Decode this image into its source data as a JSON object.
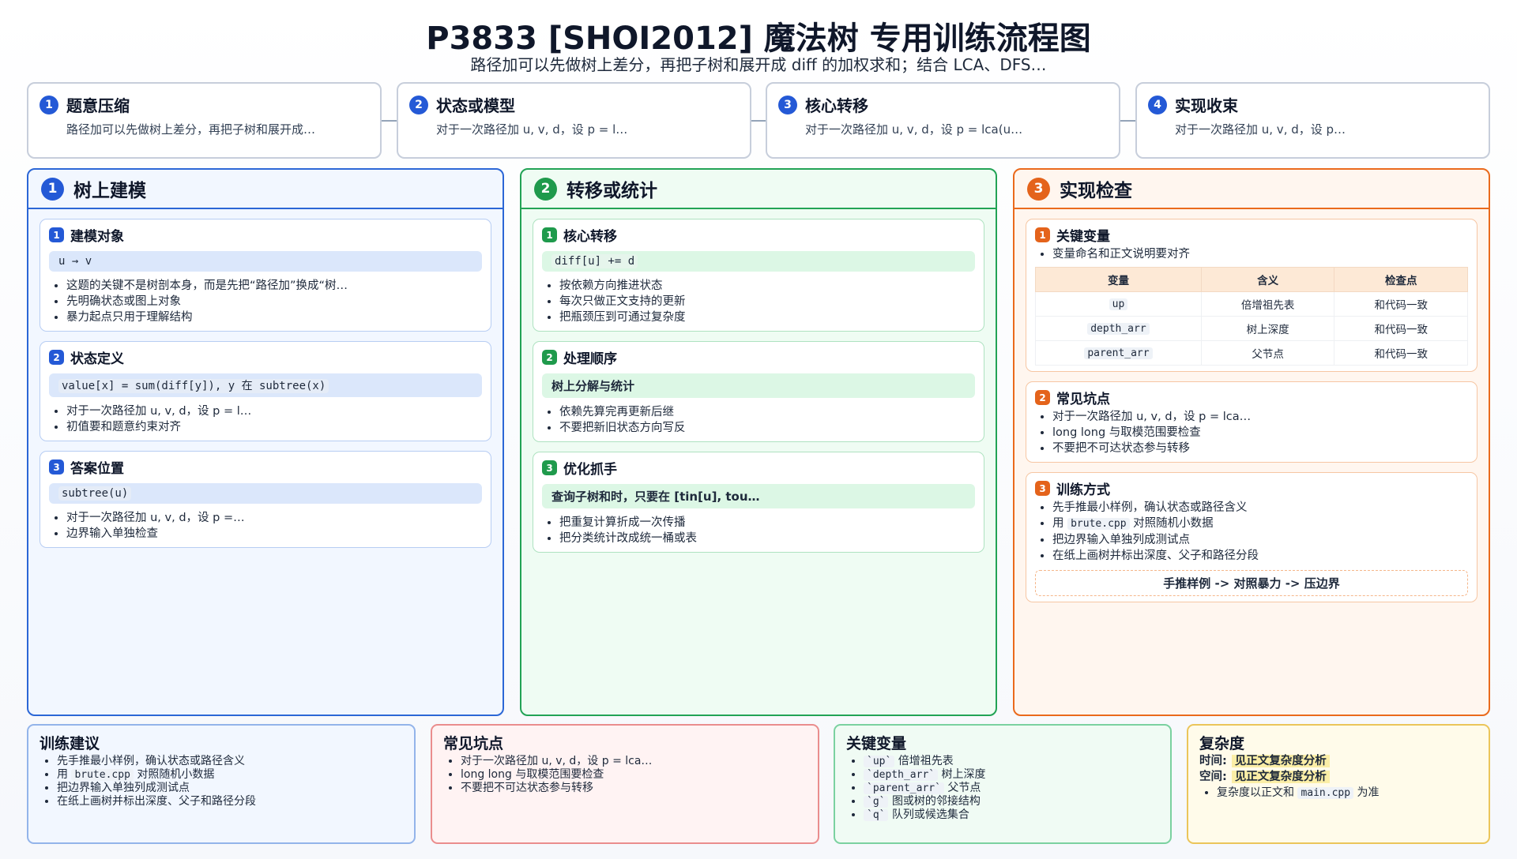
{
  "title": "P3833 [SHOI2012] 魔法树 专用训练流程图",
  "subtitle": "路径加可以先做树上差分，再把子树和展开成 diff 的加权求和；结合 LCA、DFS…",
  "colors": {
    "blue": "#2459d6",
    "green": "#1f9a4c",
    "orange": "#e4631b"
  },
  "steps": [
    {
      "num": "1",
      "title": "题意压缩",
      "desc": "路径加可以先做树上差分，再把子树和展开成…"
    },
    {
      "num": "2",
      "title": "状态或模型",
      "desc": "对于一次路径加 u, v, d，设 p = l…"
    },
    {
      "num": "3",
      "title": "核心转移",
      "desc": "对于一次路径加 u, v, d，设 p = lca(u…"
    },
    {
      "num": "4",
      "title": "实现收束",
      "desc": "对于一次路径加 u, v, d，设 p…"
    }
  ],
  "columns": [
    {
      "num": "1",
      "title": "树上建模",
      "cards": [
        {
          "num": "1",
          "title": "建模对象",
          "code": "u → v",
          "bullets": [
            "这题的关键不是树剖本身，而是先把“路径加”换成“树…",
            "先明确状态或图上对象",
            "暴力起点只用于理解结构"
          ]
        },
        {
          "num": "2",
          "title": "状态定义",
          "code": "value[x] = sum(diff[y]), y 在 subtree(x)",
          "bullets": [
            "对于一次路径加 u, v, d，设 p = l…",
            "初值要和题意约束对齐"
          ]
        },
        {
          "num": "3",
          "title": "答案位置",
          "code": "subtree(u)",
          "bullets": [
            "对于一次路径加 u, v, d，设 p =…",
            "边界输入单独检查"
          ]
        }
      ]
    },
    {
      "num": "2",
      "title": "转移或统计",
      "cards": [
        {
          "num": "1",
          "title": "核心转移",
          "code": "diff[u] += d",
          "bullets": [
            "按依赖方向推进状态",
            "每次只做正文支持的更新",
            "把瓶颈压到可通过复杂度"
          ]
        },
        {
          "num": "2",
          "title": "处理顺序",
          "code": "树上分解与统计",
          "bullets": [
            "依赖先算完再更新后继",
            "不要把新旧状态方向写反"
          ]
        },
        {
          "num": "3",
          "title": "优化抓手",
          "code": "查询子树和时，只要在 [tin[u], tou…",
          "bullets": [
            "把重复计算折成一次传播",
            "把分类统计改成统一桶或表"
          ]
        }
      ]
    },
    {
      "num": "3",
      "title": "实现检查",
      "vars_card": {
        "num": "1",
        "title": "关键变量",
        "note": "变量命名和正文说明要对齐",
        "headers": [
          "变量",
          "含义",
          "检查点"
        ],
        "rows": [
          [
            "up",
            "倍增祖先表",
            "和代码一致"
          ],
          [
            "depth_arr",
            "树上深度",
            "和代码一致"
          ],
          [
            "parent_arr",
            "父节点",
            "和代码一致"
          ]
        ]
      },
      "pitfalls_card": {
        "num": "2",
        "title": "常见坑点",
        "bullets": [
          "对于一次路径加 u, v, d，设 p = lca…",
          "long long 与取模范围要检查",
          "不要把不可达状态参与转移"
        ]
      },
      "training_card": {
        "num": "3",
        "title": "训练方式",
        "bullets": [
          "先手推最小样例，确认状态或路径含义",
          "用",
          "把边界输入单独列成测试点",
          "在纸上画树并标出深度、父子和路径分段"
        ],
        "brute_code": "brute.cpp",
        "brute_after": "对照随机小数据",
        "flow": "手推样例 -> 对照暴力 -> 压边界"
      }
    }
  ],
  "bottom": {
    "training": {
      "title": "训练建议",
      "b1": "先手推最小样例，确认状态或路径含义",
      "b2_pre": "用",
      "b2_code": "brute.cpp",
      "b2_post": "对照随机小数据",
      "b3": "把边界输入单独列成测试点",
      "b4": "在纸上画树并标出深度、父子和路径分段"
    },
    "pitfalls": {
      "title": "常见坑点",
      "items": [
        "对于一次路径加 u, v, d，设 p = lca…",
        "long long 与取模范围要检查",
        "不要把不可达状态参与转移"
      ]
    },
    "vars": {
      "title": "关键变量",
      "items": [
        {
          "code": "`up`",
          "desc": "倍增祖先表"
        },
        {
          "code": "`depth_arr`",
          "desc": "树上深度"
        },
        {
          "code": "`parent_arr`",
          "desc": "父节点"
        },
        {
          "code": "`g`",
          "desc": "图或树的邻接结构"
        },
        {
          "code": "`q`",
          "desc": "队列或候选集合"
        }
      ]
    },
    "complexity": {
      "title": "复杂度",
      "time_label": "时间:",
      "time_value": "见正文复杂度分析",
      "space_label": "空间:",
      "space_value": "见正文复杂度分析",
      "note_pre": "复杂度以正文和",
      "note_code": "main.cpp",
      "note_post": "为准"
    }
  }
}
